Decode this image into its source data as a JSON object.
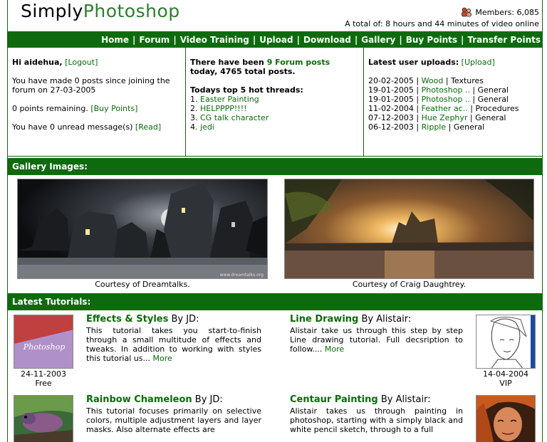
{
  "header": {
    "logo_part1": "Simply",
    "logo_part2": "Photoshop",
    "members": "Members: 6,085",
    "total": "A total of: 8 hours and 44 minutes of video online"
  },
  "nav": {
    "items": [
      "Home",
      "Forum",
      "Video Training",
      "Upload",
      "Download",
      "Gallery",
      "Buy Points",
      "Transfer Points"
    ],
    "separator": "|"
  },
  "user_panel": {
    "greeting": "Hi aidehua,",
    "logout": "[Logout]",
    "posts_line": "You have made 0 posts since joining the forum on 27-03-2005",
    "points": "0 points remaining.",
    "buy_points": "[Buy Points]",
    "messages": "You have 0 unread message(s)",
    "read": "[Read]"
  },
  "forum_panel": {
    "line1_pre": "There have been ",
    "line1_link": "9 Forum posts",
    "line2": "today, 4765 total posts.",
    "hot_title": "Todays top 5 hot threads:",
    "threads": [
      "Easter Painting",
      "HELPPPP!!!!",
      "CG talk character",
      "jedi"
    ]
  },
  "uploads_panel": {
    "title": "Latest user uploads:",
    "upload_link": "[Upload]",
    "items": [
      {
        "date": "20-02-2005",
        "name": "Wood",
        "category": "Textures"
      },
      {
        "date": "19-01-2005",
        "name": "Photoshop ..",
        "category": "General"
      },
      {
        "date": "19-01-2005",
        "name": "Photoshop ..",
        "category": "General"
      },
      {
        "date": "11-02-2004",
        "name": "Feather ac..",
        "category": "Procedures"
      },
      {
        "date": "07-12-2003",
        "name": "Hue Zephyr",
        "category": "General"
      },
      {
        "date": "06-12-2003",
        "name": "Ripple",
        "category": "General"
      }
    ]
  },
  "gallery": {
    "title": "Gallery Images:",
    "caption1": "Courtesy of Dreamtalks.",
    "caption2": "Courtesy of Craig Daughtrey.",
    "watermark1": "www.dreamtalks.org"
  },
  "tutorials": {
    "title": "Latest Tutorials:",
    "items": [
      {
        "title": "Effects & Styles",
        "by": " By JD:",
        "desc": "This tutorial takes you start-to-finish through a small multitude of effects and tweaks. In addition to working with styles this tutorial us...",
        "more": "More",
        "date": "24-11-2003",
        "access": "Free",
        "thumb_text": "Photoshop"
      },
      {
        "title": "Line Drawing",
        "by": " By Alistair:",
        "desc": "Alistair take us through this step by step Line drawing tutorial. Full decsription to follow....",
        "more": "More",
        "date": "14-04-2004",
        "access": "VIP"
      },
      {
        "title": "Rainbow Chameleon",
        "by": " By JD:",
        "desc": "This tutorial focuses primarily on selective colors, multiple adjustment layers and layer masks. Also alternate effects are"
      },
      {
        "title": "Centaur Painting",
        "by": " By Alistair:",
        "desc": "Alistair takes us through painting in photoshop, starting with a simply black and white pencil sketch, through to a full"
      }
    ]
  },
  "colors": {
    "green_bar": "#0d6b0d",
    "link_green": "#0a6a0a",
    "logo_green": "#2e7d2e"
  }
}
